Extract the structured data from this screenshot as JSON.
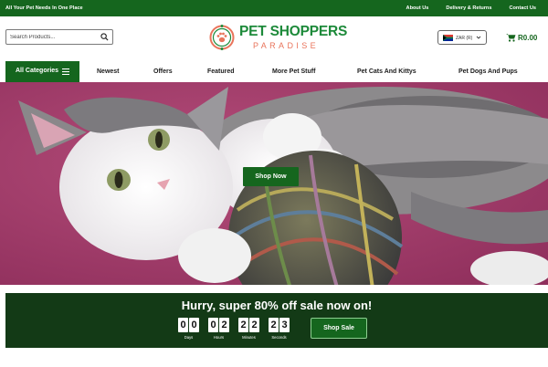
{
  "topbar": {
    "tagline": "All Your Pet Needs In One Place",
    "links": [
      "About Us",
      "Delivery & Returns",
      "Contact Us"
    ]
  },
  "header": {
    "search_placeholder": "Search Products...",
    "logo_line1": "PET SHOPPERS",
    "logo_line2": "PARADISE",
    "currency": "ZAR (R)",
    "cart_amount": "R0.00"
  },
  "nav": {
    "all_categories": "All Categories",
    "items": [
      "Newest",
      "Offers",
      "Featured",
      "More Pet Stuff",
      "Pet Cats And Kittys",
      "Pet Dogs And Pups"
    ]
  },
  "hero": {
    "button": "Shop Now"
  },
  "sale": {
    "title": "Hurry, super 80% off sale now on!",
    "countdown": [
      {
        "label": "Days",
        "digits": [
          "0",
          "0"
        ]
      },
      {
        "label": "Hours",
        "digits": [
          "0",
          "2"
        ]
      },
      {
        "label": "Minutes",
        "digits": [
          "2",
          "2"
        ]
      },
      {
        "label": "Seconds",
        "digits": [
          "2",
          "3"
        ]
      }
    ],
    "button": "Shop Sale"
  },
  "colors": {
    "brand_green": "#15661e",
    "dark_green": "#133a16",
    "logo_green": "#1d8a3a",
    "logo_coral": "#e9745b",
    "hero_background": "#a43e6b"
  },
  "icons": [
    "search-icon",
    "logo-emblem",
    "flag-icon",
    "chevron-down-icon",
    "cart-icon",
    "menu-icon"
  ]
}
